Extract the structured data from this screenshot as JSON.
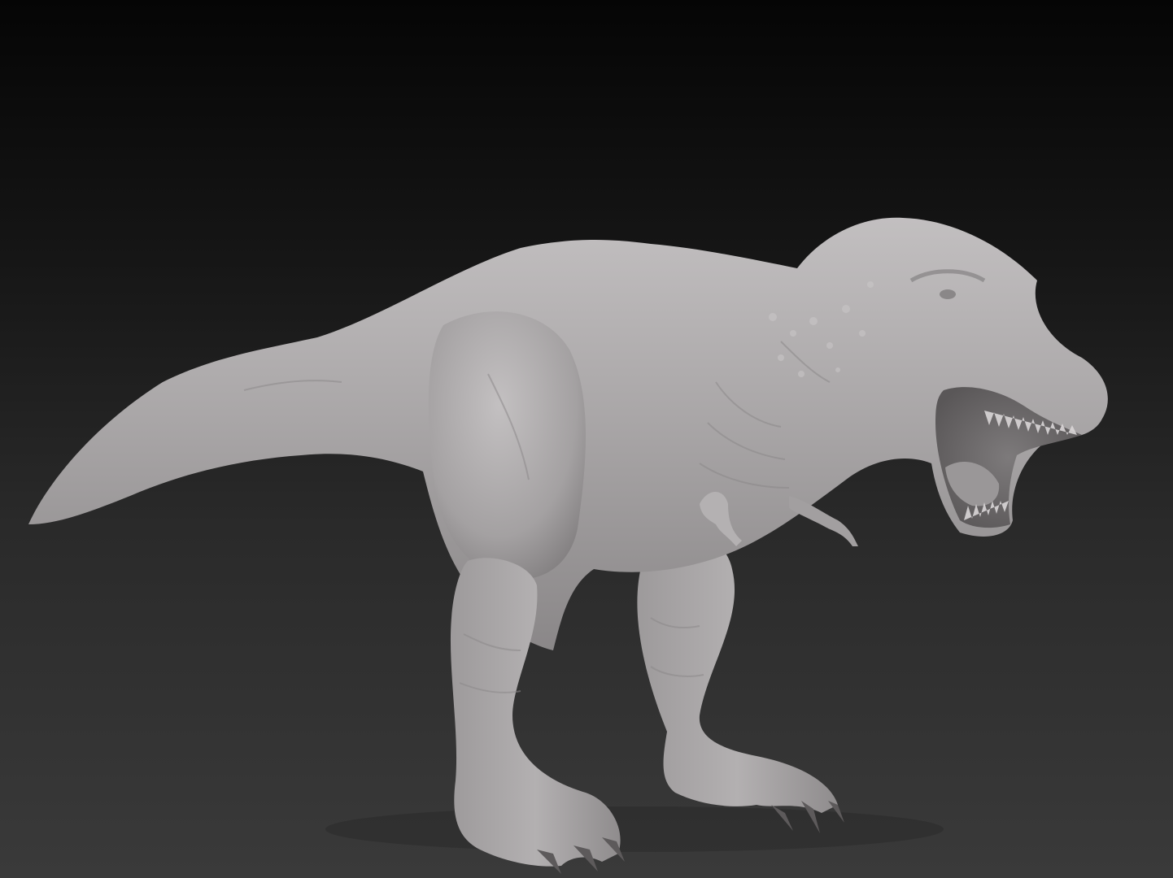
{
  "scene": {
    "subject": "t-rex-sculpt",
    "background_top_color": "#050505",
    "background_bottom_color": "#3a3a3a",
    "material_color": "#a9a6a7",
    "material_shadow_color": "#6f6c6e",
    "material_highlight_color": "#c9c6c7"
  }
}
